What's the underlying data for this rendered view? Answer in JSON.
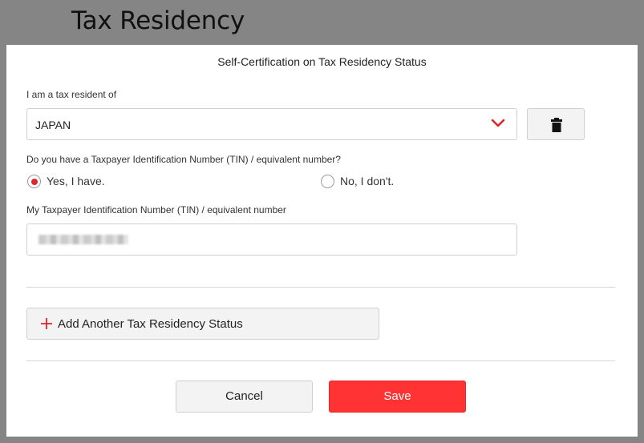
{
  "page": {
    "title": "Tax Residency"
  },
  "modal": {
    "title": "Self-Certification on Tax Residency Status",
    "residency": {
      "label": "I am a tax resident of",
      "selected": "JAPAN",
      "chevron_icon": "chevron-down-icon",
      "delete_icon": "trash-icon"
    },
    "tin_question": {
      "label": "Do you have a Taxpayer Identification Number (TIN) / equivalent number?",
      "options": [
        {
          "label": "Yes, I have.",
          "checked": true
        },
        {
          "label": "No, I don't.",
          "checked": false
        }
      ]
    },
    "tin_field": {
      "label": "My Taxpayer Identification Number (TIN) / equivalent number",
      "value_obscured": true
    },
    "add_button": {
      "label": "Add Another Tax Residency Status",
      "icon": "plus-icon"
    },
    "cancel_button": {
      "label": "Cancel"
    },
    "save_button": {
      "label": "Save"
    }
  },
  "colors": {
    "accent": "#ff3333",
    "radio_checked": "#e0262d",
    "backdrop": "#858585"
  }
}
